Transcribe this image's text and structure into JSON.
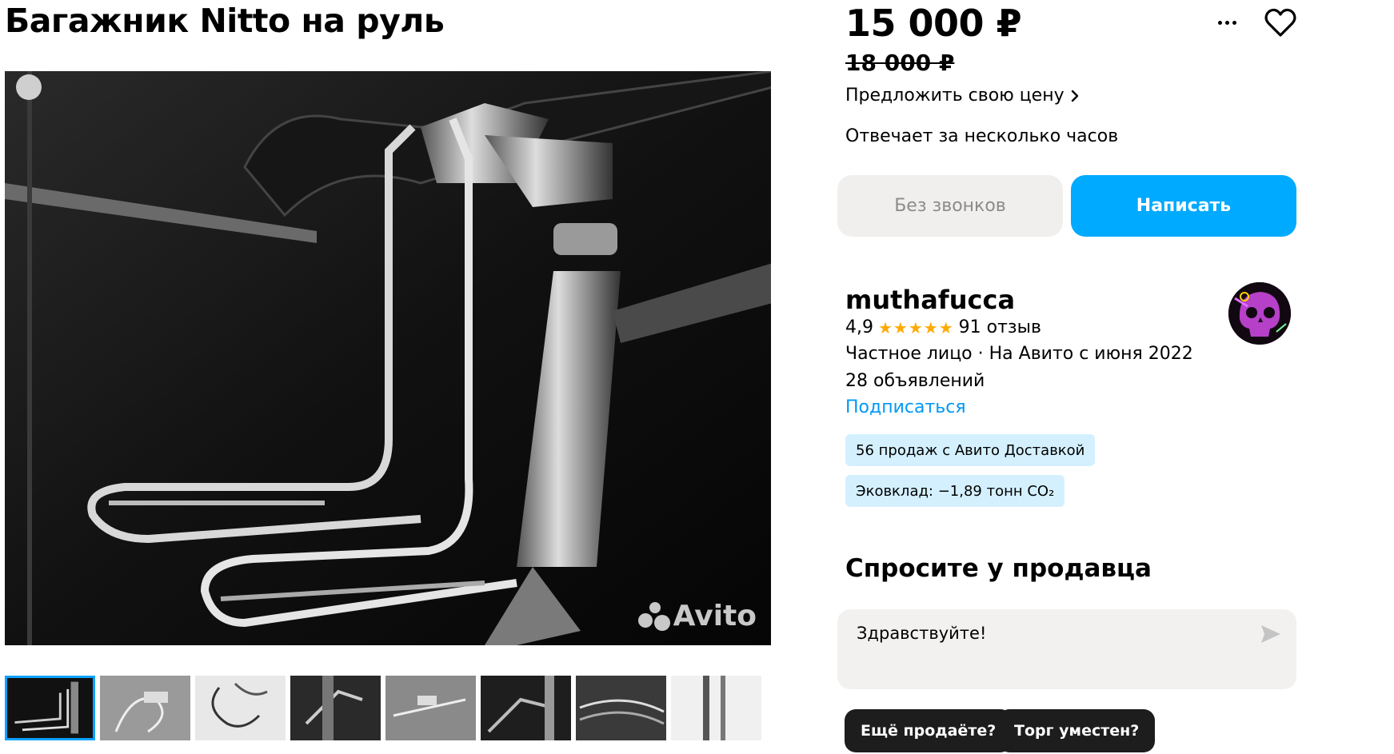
{
  "listing": {
    "title": "Багажник Nitto на руль",
    "price": "15 000 ₽",
    "old_price": "18 000 ₽",
    "offer_price_link": "Предложить свою цену",
    "replies_info": "Отвечает за несколько часов"
  },
  "gallery": {
    "watermark": "Avito",
    "thumbnail_count": 8,
    "active_index": 0
  },
  "actions": {
    "no_calls_label": "Без звонков",
    "write_label": "Написать"
  },
  "seller": {
    "name": "muthafucca",
    "rating": "4,9",
    "stars": 5,
    "reviews": "91 отзыв",
    "type": "Частное лицо · На Авито с июня 2022",
    "listings": "28 объявлений",
    "subscribe_label": "Подписаться",
    "badge_sales": "56 продаж с Авито Доставкой",
    "badge_eco": "Эковклад: −1,89 тонн CO₂"
  },
  "ask": {
    "title": "Спросите у продавца",
    "message_value": "Здравствуйте!",
    "quick_replies": [
      "Ещё продаёте?",
      "Торг уместен?"
    ]
  },
  "colors": {
    "accent": "#00aaff",
    "link": "#0099f7",
    "badge_bg": "#d4f0ff",
    "star": "#ffaa00"
  }
}
